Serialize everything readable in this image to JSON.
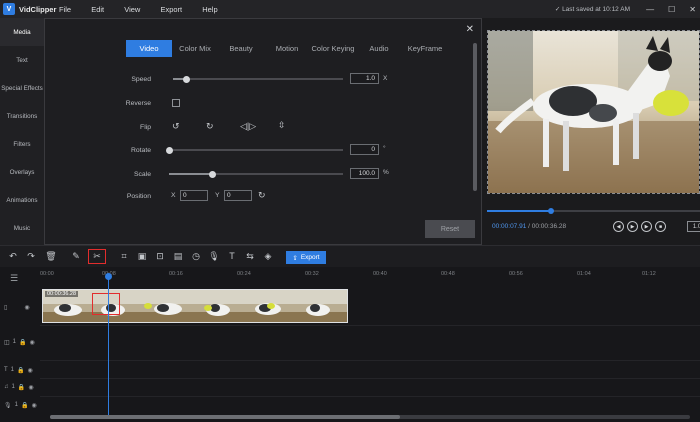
{
  "app": {
    "name": "VidClipper",
    "saved_status": "✓ Last saved at 10:12 AM"
  },
  "menu": [
    "File",
    "Edit",
    "View",
    "Export",
    "Help"
  ],
  "window_controls": [
    "—",
    "☐",
    "✕"
  ],
  "sidebar": {
    "items": [
      {
        "label": "Media",
        "active": true
      },
      {
        "label": "Text",
        "active": false
      },
      {
        "label": "Special Effects",
        "active": false
      },
      {
        "label": "Transitions",
        "active": false
      },
      {
        "label": "Filters",
        "active": false
      },
      {
        "label": "Overlays",
        "active": false
      },
      {
        "label": "Animations",
        "active": false
      },
      {
        "label": "Music",
        "active": false
      }
    ]
  },
  "dialog": {
    "tabs": [
      "Video",
      "Color Mix",
      "Beauty",
      "Motion",
      "Color Keying",
      "Audio",
      "KeyFrame"
    ],
    "active_tab": "Video",
    "speed": {
      "label": "Speed",
      "value": "1.0",
      "unit": "X",
      "fraction": 0.08
    },
    "reverse": {
      "label": "Reverse",
      "checked": false
    },
    "flip": {
      "label": "Flip"
    },
    "rotate": {
      "label": "Rotate",
      "value": "0",
      "unit": "°",
      "fraction": 0.0
    },
    "scale": {
      "label": "Scale",
      "value": "100.0",
      "unit": "%",
      "fraction": 0.25
    },
    "position": {
      "label": "Position",
      "x_label": "X",
      "x_value": "0",
      "y_label": "Y",
      "y_value": "0"
    },
    "reset_label": "Reset"
  },
  "preview": {
    "current_time": "00:00:07.91",
    "total_time": "/ 00:00:36.28",
    "progress_fraction": 0.3,
    "zoom_label": "1.0"
  },
  "toolbar": {
    "export_label": "Export"
  },
  "timeline": {
    "ruler": [
      "00:00",
      "00:08",
      "00:16",
      "00:24",
      "00:32",
      "00:40",
      "00:48",
      "00:56",
      "01:04",
      "01:12"
    ],
    "clip_label": "00:00:36.28",
    "tracks": [
      "1",
      "1",
      "1",
      "1"
    ]
  }
}
